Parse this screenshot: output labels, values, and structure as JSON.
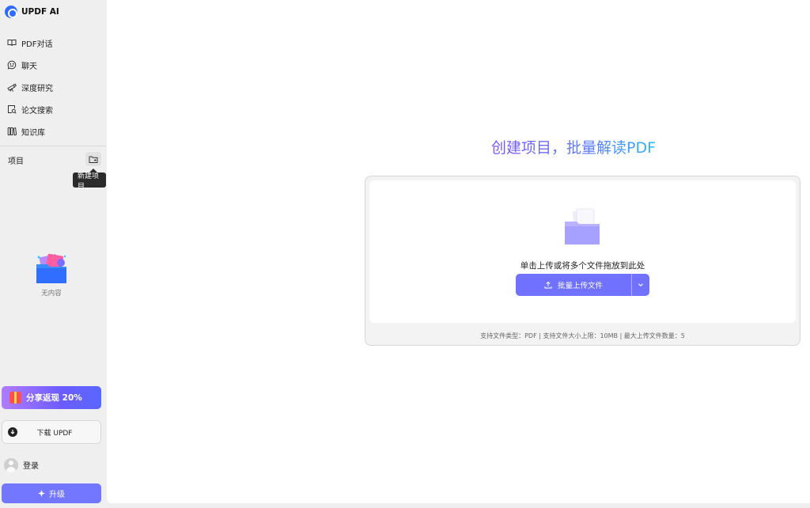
{
  "brand": {
    "name": "UPDF AI",
    "logo_icon": "updf-logo-icon"
  },
  "sidebar": {
    "nav": [
      {
        "label": "PDF对话",
        "icon": "book-open-icon"
      },
      {
        "label": "聊天",
        "icon": "chat-smile-icon"
      },
      {
        "label": "深度研究",
        "icon": "telescope-icon"
      },
      {
        "label": "论文搜索",
        "icon": "paper-search-icon"
      },
      {
        "label": "知识库",
        "icon": "library-icon"
      }
    ],
    "projects_label": "项目",
    "new_project_tooltip": "新建项目",
    "empty_text": "无内容",
    "promo_label": "分享返现 20%",
    "download_label": "下载 UPDF",
    "login_label": "登录",
    "upgrade_label": "升级"
  },
  "main": {
    "headline": "创建项目，批量解读PDF",
    "drop_text": "单击上传或将多个文件拖放到此处",
    "upload_button_label": "批量上传文件",
    "limits_text": "支持文件类型：PDF  |  支持文件大小上限：10MB  |  最大上传文件数量：5"
  },
  "colors": {
    "accent": "#7072ff",
    "headline_gradient": [
      "#7b55ff",
      "#2bb6ff"
    ],
    "promo_gradient": [
      "#b07cff",
      "#5a66ff"
    ]
  }
}
